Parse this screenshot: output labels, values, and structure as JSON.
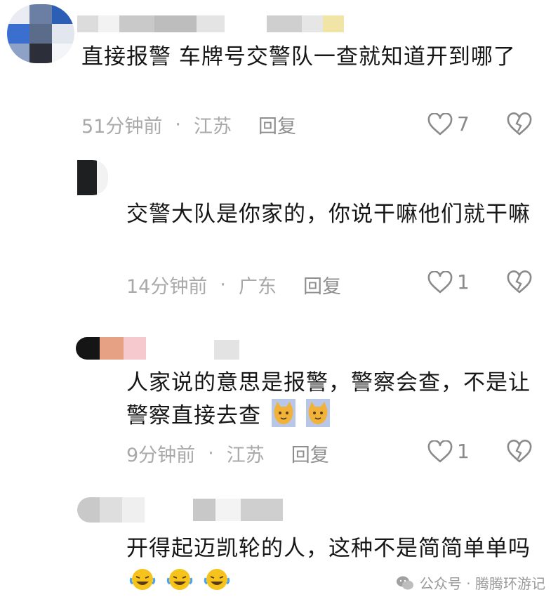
{
  "comments": [
    {
      "text": "直接报警 车牌号交警队一查就知道开到哪了",
      "time": "51分钟前",
      "region": "江苏",
      "reply_label": "回复",
      "likes": "7"
    },
    {
      "text": "交警大队是你家的，你说干嘛他们就干嘛",
      "time": "14分钟前",
      "region": "广东",
      "reply_label": "回复",
      "likes": "1"
    },
    {
      "text": "人家说的意思是报警，警察会查，不是让警察直接去查",
      "time": "9分钟前",
      "region": "江苏",
      "reply_label": "回复",
      "likes": "1"
    },
    {
      "text": "开得起迈凯轮的人，这种不是简简单单吗",
      "time": "",
      "region": "",
      "reply_label": "",
      "likes": ""
    }
  ],
  "separator": "·",
  "watermark": "公众号 · 腾腾环游记",
  "colors": {
    "text": "#161616",
    "meta": "#a9a9a9",
    "icon": "#8a8a8a"
  },
  "icons": [
    "heart-outline-icon",
    "broken-heart-icon",
    "cat-emoji-icon",
    "laughing-crying-emoji-icon",
    "wechat-icon"
  ]
}
